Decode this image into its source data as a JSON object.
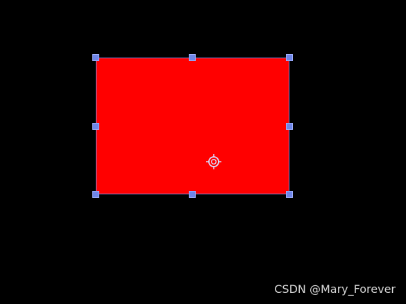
{
  "canvas": {
    "background_color": "#000000"
  },
  "selection": {
    "fill_color": "#ff0000",
    "handle_color": "#6f86e8",
    "anchor_icon": "anchor-point-icon"
  },
  "watermark": {
    "text": "CSDN @Mary_Forever"
  }
}
